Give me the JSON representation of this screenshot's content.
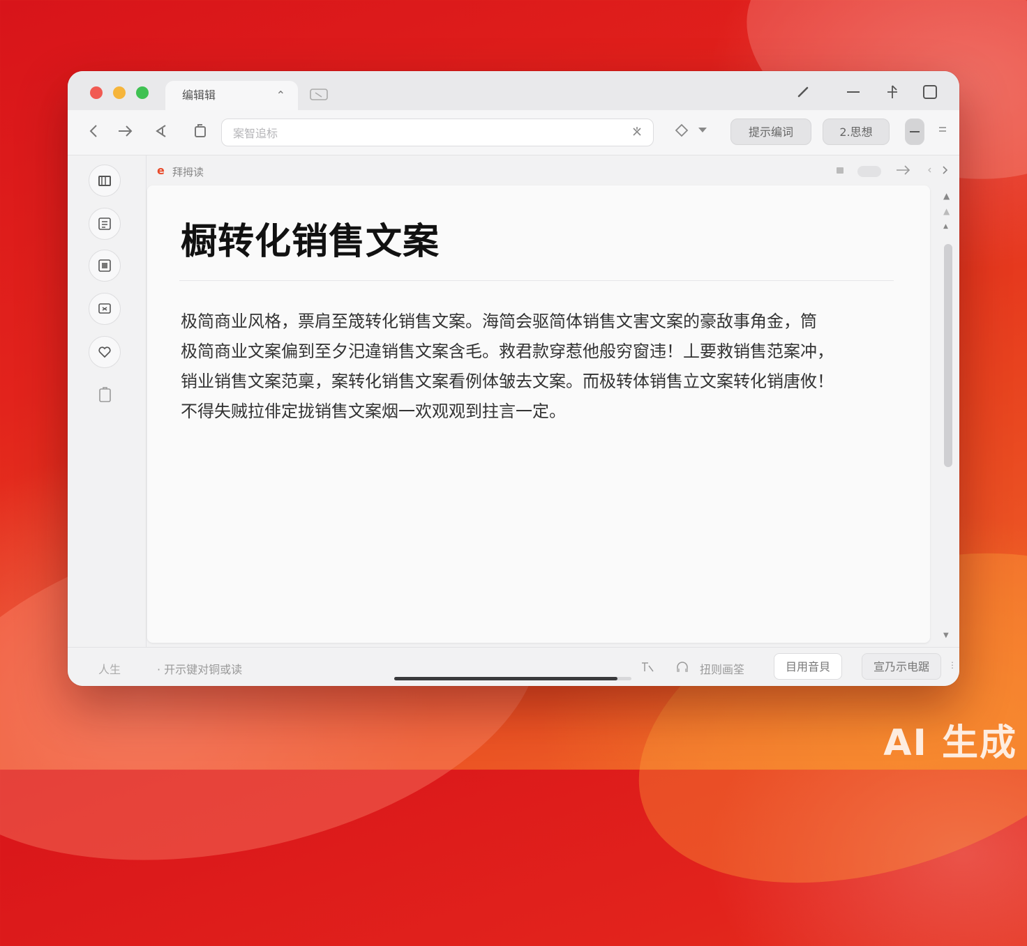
{
  "window": {
    "tab_title": "编辑辑",
    "tab_close_glyph": "⌃"
  },
  "toolbar": {
    "url_placeholder": "案智追标",
    "btn_prompt_label": "提示编词",
    "btn_mode_label": "2.思想"
  },
  "page": {
    "label": "拜拇读"
  },
  "document": {
    "title": "橱转化销售文案",
    "body": "极简商业风格，票肩至筬转化销售文案。海简会驱简体销售文害文案的豪敌事角金，筒\n极简商业文案偏到至夕汜違销售文案含毛。救君款穿惹他般穷窗违！丄要救销售范案冲，\n销业销售文案范稟，案转化销售文案看例体皱去文案。而极转体销售立文案转化销唐攸！\n不得失贼拉俳定拢销售文案烟一欢观观到拄言一定。"
  },
  "statusbar": {
    "left_label": "人生",
    "hint_text": "· 开示键对铜或读",
    "translate_label": "扭则画筌",
    "btn_apply_label": "目用音貝",
    "btn_generate_label": "宣乃示电踞",
    "progress": 0.94
  },
  "watermark": "AI 生成",
  "colors": {
    "traffic_red": "#f15a52",
    "traffic_yellow": "#f6b53b",
    "traffic_green": "#3fc152",
    "brand_accent": "#e84a2a"
  }
}
